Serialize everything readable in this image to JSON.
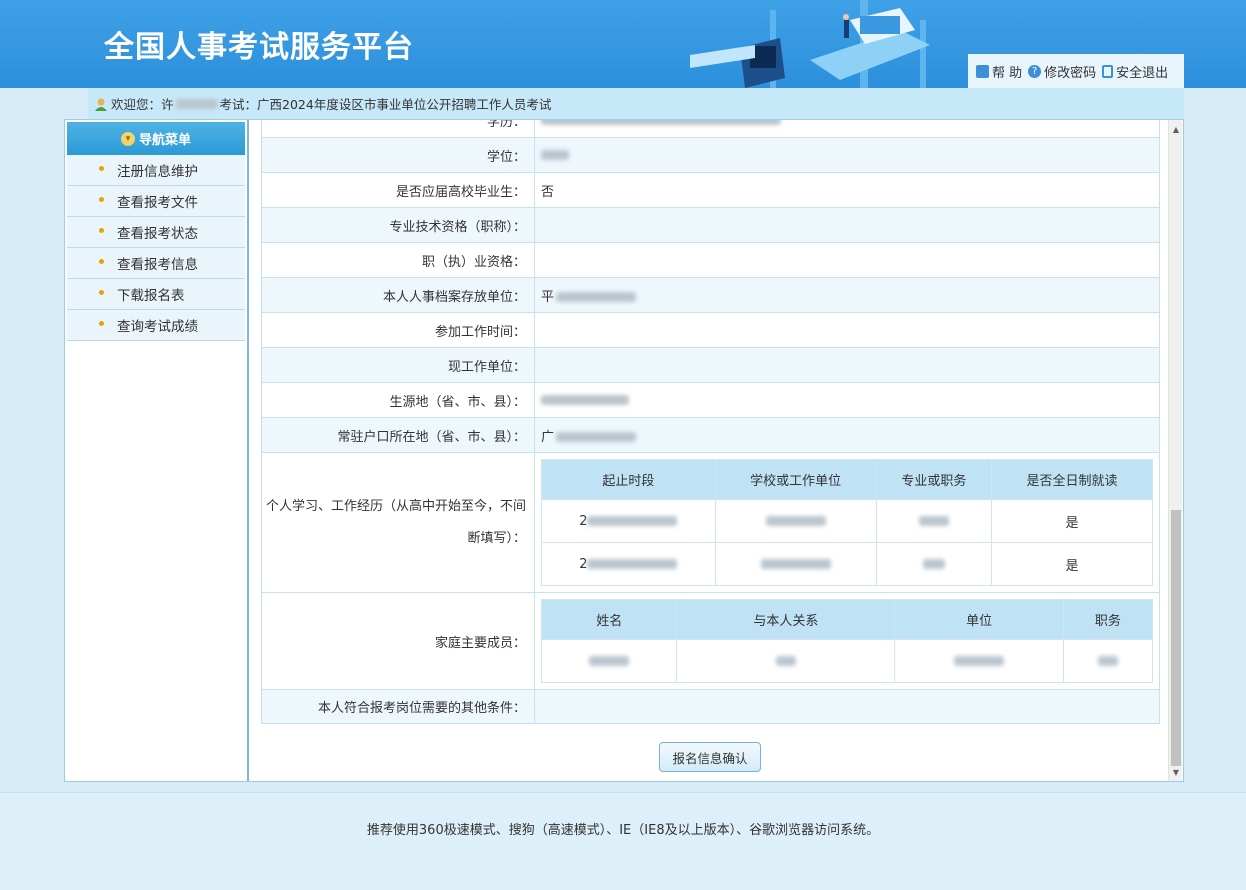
{
  "header": {
    "title": "全国人事考试服务平台",
    "links": [
      {
        "label": "帮 助",
        "icon": "lock-icon"
      },
      {
        "label": "修改密码",
        "icon": "question-icon"
      },
      {
        "label": "安全退出",
        "icon": "exit-icon"
      }
    ]
  },
  "welcome": {
    "prefix": "欢迎您：许",
    "exam_label": "考试：广西2024年度设区市事业单位公开招聘工作人员考试"
  },
  "sidebar": {
    "title": "导航菜单",
    "items": [
      {
        "label": "注册信息维护"
      },
      {
        "label": "查看报考文件"
      },
      {
        "label": "查看报考状态"
      },
      {
        "label": "查看报考信息"
      },
      {
        "label": "下载报名表"
      },
      {
        "label": "查询考试成绩"
      }
    ]
  },
  "form": {
    "rows": [
      {
        "label": "学历：",
        "value": ""
      },
      {
        "label": "学位：",
        "value": ""
      },
      {
        "label": "是否应届高校毕业生：",
        "value": "否"
      },
      {
        "label": "专业技术资格（职称）：",
        "value": ""
      },
      {
        "label": "职（执）业资格：",
        "value": ""
      },
      {
        "label": "本人人事档案存放单位：",
        "value": "平"
      },
      {
        "label": "参加工作时间：",
        "value": ""
      },
      {
        "label": "现工作单位：",
        "value": ""
      },
      {
        "label": "生源地（省、市、县）：",
        "value": ""
      },
      {
        "label": "常驻户口所在地（省、市、县）：",
        "value": "广"
      }
    ],
    "experience": {
      "label_line1": "个人学习、工作经历（从高中开始至今，不间",
      "label_line2": "断填写）：",
      "headers": [
        "起止时段",
        "学校或工作单位",
        "专业或职务",
        "是否全日制就读"
      ],
      "rows": [
        [
          "2",
          "",
          "",
          "是"
        ],
        [
          "2",
          "",
          "",
          "是"
        ]
      ]
    },
    "family": {
      "label": "家庭主要成员：",
      "headers": [
        "姓名",
        "与本人关系",
        "单位",
        "职务"
      ],
      "rows": [
        [
          "",
          "",
          "",
          ""
        ]
      ]
    },
    "other": {
      "label": "本人符合报考岗位需要的其他条件：",
      "value": ""
    },
    "confirm_label": "报名信息确认"
  },
  "footer": {
    "text": "推荐使用360极速模式、搜狗（高速模式）、IE（IE8及以上版本）、谷歌浏览器访问系统。"
  },
  "colors": {
    "header_bg": "#2c8fdc",
    "sidebar_head": "#2a9ad6",
    "table_header": "#bfe3f5"
  }
}
